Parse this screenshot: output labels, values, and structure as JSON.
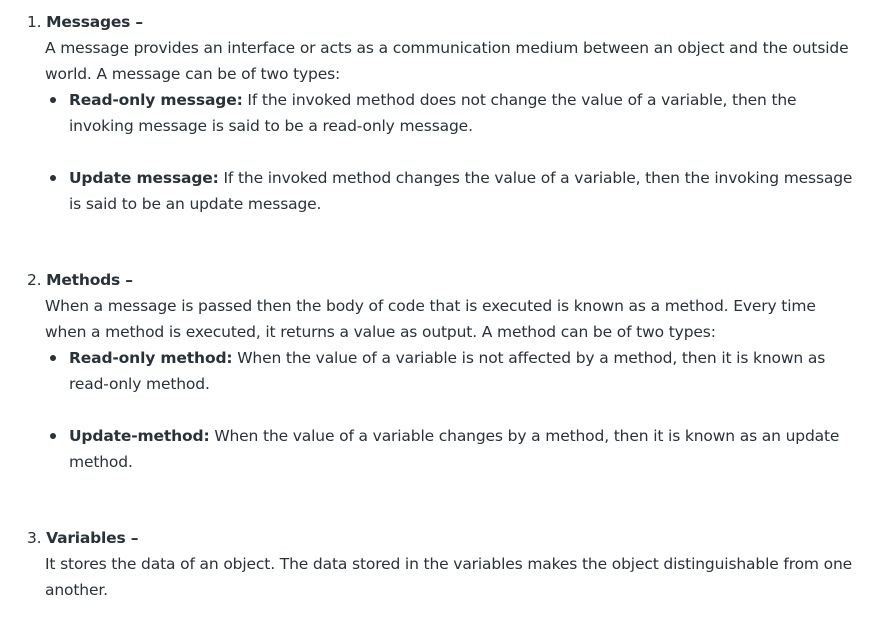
{
  "items": [
    {
      "number": "1.",
      "title": "Messages –",
      "description": "A message provides an interface or acts as a communication medium between an object and the outside world. A message can be of two types:",
      "bullets": [
        {
          "term": "Read-only message:",
          "text": " If the invoked method does not change the value of a variable, then the invoking message is said to be a read-only message."
        },
        {
          "term": "Update message:",
          "text": " If the invoked method changes the value of a variable, then the invoking message is said to be an update message."
        }
      ]
    },
    {
      "number": "2.",
      "title": "Methods –",
      "description": "When a message is passed then the body of code that is executed is known as a method. Every time when a method is executed, it returns a value as output. A method can be of two types:",
      "bullets": [
        {
          "term": "Read-only method:",
          "text": " When the value of a variable is not affected by a method, then it is known as read-only method."
        },
        {
          "term": "Update-method:",
          "text": " When the value of a variable changes by a method, then it is known as an update method."
        }
      ]
    },
    {
      "number": "3.",
      "title": "Variables –",
      "description": "It stores the data of an object. The data stored in the variables makes the object distinguishable from one another.",
      "bullets": []
    }
  ]
}
